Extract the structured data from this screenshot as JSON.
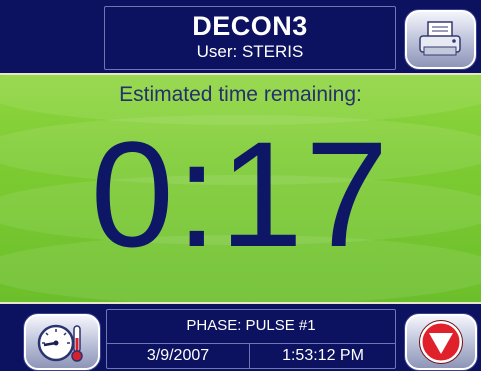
{
  "header": {
    "title": "DECON3",
    "user": "User: STERIS"
  },
  "main": {
    "estimated_label": "Estimated time remaining:",
    "time_remaining": "0:17"
  },
  "footer": {
    "phase": "PHASE: PULSE #1",
    "date": "3/9/2007",
    "time": "1:53:12 PM"
  },
  "icons": {
    "print": "printer-icon",
    "gauge": "gauge-thermometer-icon",
    "down": "down-arrow-icon"
  },
  "colors": {
    "panel_blue": "#0c1260",
    "screen_green": "#7ccb32",
    "time_text": "#0d1766",
    "down_red": "#e0202a"
  }
}
